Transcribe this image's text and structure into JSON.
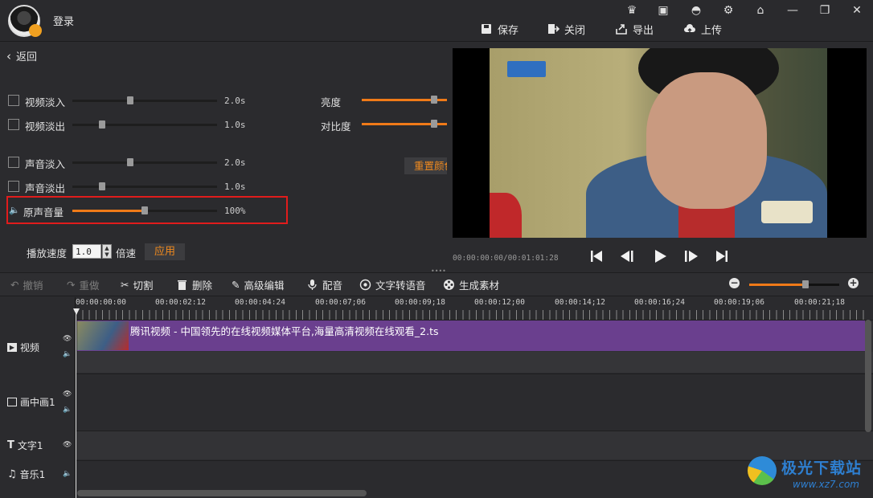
{
  "header": {
    "login_label": "登录",
    "toolbar": {
      "save": "保存",
      "close": "关闭",
      "export": "导出",
      "upload": "上传"
    }
  },
  "left_panel": {
    "back_label": "返回",
    "video_fade_in": {
      "label": "视频淡入",
      "value_text": "2.0s",
      "level": 0.4
    },
    "video_fade_out": {
      "label": "视频淡出",
      "value_text": "1.0s",
      "level": 0.2
    },
    "audio_fade_in": {
      "label": "声音淡入",
      "value_text": "2.0s",
      "level": 0.4
    },
    "audio_fade_out": {
      "label": "声音淡出",
      "value_text": "1.0s",
      "level": 0.2
    },
    "original_volume": {
      "label": "原声音量",
      "value_text": "100%",
      "level": 0.5
    },
    "brightness_label": "亮度",
    "contrast_label": "对比度",
    "reset_color_label": "重置颜色",
    "speed_label": "播放速度",
    "speed_value": "1.0",
    "speed_unit": "倍速",
    "apply_label": "应用"
  },
  "preview": {
    "timecode": "00:00:00:00/00:01:01:28"
  },
  "edit_toolbar": {
    "undo": "撤销",
    "redo": "重做",
    "cut": "切割",
    "delete": "删除",
    "advanced_edit": "高级编辑",
    "dub": "配音",
    "tts": "文字转语音",
    "generate": "生成素材",
    "zoom_level": 0.62
  },
  "timeline": {
    "ticks": [
      "00:00:00:00",
      "00:00:02:12",
      "00:00:04:24",
      "00:00:07;06",
      "00:00:09;18",
      "00:00:12;00",
      "00:00:14;12",
      "00:00:16;24",
      "00:00:19;06",
      "00:00:21;18"
    ],
    "tracks": {
      "video": "视频",
      "pip": "画中画1",
      "text": "文字1",
      "music": "音乐1"
    },
    "clip_title": "腾讯视频 - 中国领先的在线视频媒体平台,海量高清视频在线观看_2.ts"
  },
  "watermark": {
    "name": "极光下载站",
    "url": "www.xz7.com"
  },
  "colors": {
    "accent": "#f07a18",
    "highlight_box": "#e11c1c",
    "clip": "#6a3f8e"
  }
}
